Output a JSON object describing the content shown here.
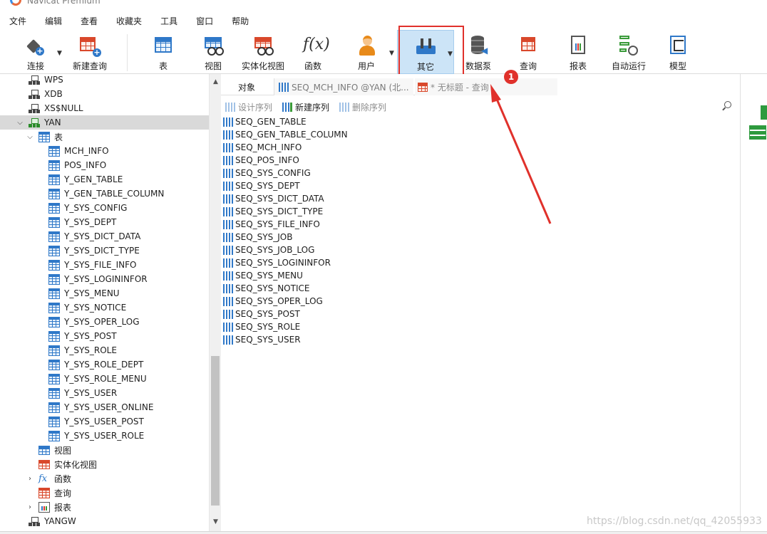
{
  "app": {
    "title": "Navicat Premium"
  },
  "menubar": [
    "文件",
    "编辑",
    "查看",
    "收藏夹",
    "工具",
    "窗口",
    "帮助"
  ],
  "toolbar": {
    "connect": "连接",
    "new_query": "新建查询",
    "table": "表",
    "view": "视图",
    "materialized_view": "实体化视图",
    "function": "函数",
    "user": "用户",
    "other": "其它",
    "data_pump": "数据泵",
    "query": "查询",
    "report": "报表",
    "automation": "自动运行",
    "model": "模型"
  },
  "tree": {
    "servers_above": [
      "WPS",
      "XDB",
      "XS$NULL"
    ],
    "schema": "YAN",
    "tables_group": "表",
    "tables": [
      "MCH_INFO",
      "POS_INFO",
      "Y_GEN_TABLE",
      "Y_GEN_TABLE_COLUMN",
      "Y_SYS_CONFIG",
      "Y_SYS_DEPT",
      "Y_SYS_DICT_DATA",
      "Y_SYS_DICT_TYPE",
      "Y_SYS_FILE_INFO",
      "Y_SYS_LOGININFOR",
      "Y_SYS_MENU",
      "Y_SYS_NOTICE",
      "Y_SYS_OPER_LOG",
      "Y_SYS_POST",
      "Y_SYS_ROLE",
      "Y_SYS_ROLE_DEPT",
      "Y_SYS_ROLE_MENU",
      "Y_SYS_USER",
      "Y_SYS_USER_ONLINE",
      "Y_SYS_USER_POST",
      "Y_SYS_USER_ROLE"
    ],
    "views": "视图",
    "materialized_views": "实体化视图",
    "functions": "函数",
    "queries": "查询",
    "reports": "报表",
    "next_schema": "YANGW"
  },
  "tabs": {
    "objects": "对象",
    "sequence_tab": "SEQ_MCH_INFO @YAN (北...",
    "query_tab": "* 无标题 - 查询"
  },
  "object_toolbar": {
    "design": "设计序列",
    "new": "新建序列",
    "delete": "删除序列"
  },
  "sequences": [
    "SEQ_GEN_TABLE",
    "SEQ_GEN_TABLE_COLUMN",
    "SEQ_MCH_INFO",
    "SEQ_POS_INFO",
    "SEQ_SYS_CONFIG",
    "SEQ_SYS_DEPT",
    "SEQ_SYS_DICT_DATA",
    "SEQ_SYS_DICT_TYPE",
    "SEQ_SYS_FILE_INFO",
    "SEQ_SYS_JOB",
    "SEQ_SYS_JOB_LOG",
    "SEQ_SYS_LOGININFOR",
    "SEQ_SYS_MENU",
    "SEQ_SYS_NOTICE",
    "SEQ_SYS_OPER_LOG",
    "SEQ_SYS_POST",
    "SEQ_SYS_ROLE",
    "SEQ_SYS_USER"
  ],
  "annotation": {
    "badge": "1",
    "color": "#e0312b"
  },
  "watermark": "https://blog.csdn.net/qq_42055933",
  "colors": {
    "accent": "#2f78c8",
    "selected_row": "#d9d9d9",
    "active_tool": "#cce4f7",
    "highlight": "#e0312b"
  }
}
